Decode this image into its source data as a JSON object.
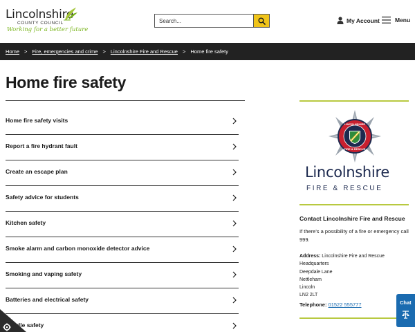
{
  "header": {
    "logo": {
      "title": "Lincolnshire",
      "subtitle": "COUNTY COUNCIL",
      "tagline": "Working for a better future"
    },
    "search": {
      "placeholder": "Search..."
    },
    "account_label": "My Account",
    "menu_label": "Menu"
  },
  "breadcrumb": {
    "items": [
      "Home",
      "Fire, emergencies and crime",
      "Lincolnshire Fire and Rescue"
    ],
    "current": "Home fire safety",
    "separator": ">"
  },
  "page": {
    "title": "Home fire safety",
    "links": [
      "Home fire safety visits",
      "Report a fire hydrant fault",
      "Create an escape plan",
      "Safety advice for students",
      "Kitchen safety",
      "Smoke alarm and carbon monoxide detector advice",
      "Smoking and vaping safety",
      "Batteries and electrical safety",
      "Candle safety"
    ]
  },
  "sidebar": {
    "brand_name": "Lincolnshire",
    "brand_sub": "FIRE & RESCUE",
    "crest_text": "LINCOLNSHIRE FIRE & RESCUE",
    "contact_title": "Contact Lincolnshire Fire and Rescue",
    "contact_text": "If there's a possibility of a fire or emergency call 999.",
    "address_label": "Address:",
    "address_lines": [
      "Lincolnshire Fire and Rescue",
      "Headquarters",
      "Deepdale Lane",
      "Nettleham",
      "Lincoln",
      "LN2 2LT"
    ],
    "telephone_label": "Telephone:",
    "telephone": "01522 555777"
  },
  "chat": {
    "label": "Chat"
  },
  "colors": {
    "accent_yellow": "#f0c419",
    "breadcrumb_bg": "#222222",
    "sidebar_rule": "#b8c940",
    "brand_navy": "#1d2a4f",
    "link_blue": "#1a6bb0",
    "logo_green": "#7ab51d"
  },
  "icons": {
    "search": "search-icon",
    "account": "person-icon",
    "menu": "hamburger-icon",
    "link_arrow": "chevron-right-icon",
    "chat": "chat-icon",
    "cookie": "cookie-settings-icon"
  }
}
